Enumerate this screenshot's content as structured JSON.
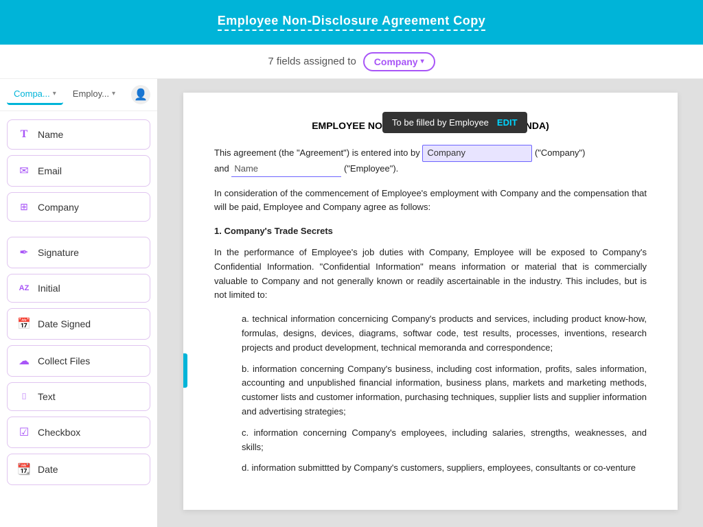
{
  "header": {
    "title": "Employee Non-Disclosure Agreement Copy"
  },
  "subheader": {
    "fields_text": "7 fields assigned to",
    "company_label": "Company",
    "chevron": "▾"
  },
  "sidebar": {
    "tabs": [
      {
        "id": "company",
        "label": "Compa...",
        "active": true
      },
      {
        "id": "employee",
        "label": "Employ...",
        "active": false
      }
    ],
    "add_icon": "+",
    "fields": [
      {
        "id": "name",
        "icon": "T",
        "icon_type": "text-t",
        "label": "Name"
      },
      {
        "id": "email",
        "icon": "✉",
        "icon_type": "email",
        "label": "Email"
      },
      {
        "id": "company",
        "icon": "⊞",
        "icon_type": "company",
        "label": "Company"
      },
      {
        "id": "signature",
        "icon": "✒",
        "icon_type": "signature",
        "label": "Signature"
      },
      {
        "id": "initial",
        "icon": "AZ",
        "icon_type": "initial",
        "label": "Initial"
      },
      {
        "id": "date-signed",
        "icon": "📅",
        "icon_type": "calendar",
        "label": "Date Signed"
      },
      {
        "id": "collect-files",
        "icon": "☁",
        "icon_type": "upload",
        "label": "Collect Files"
      },
      {
        "id": "text",
        "icon": "⌷",
        "icon_type": "text-box",
        "label": "Text"
      },
      {
        "id": "checkbox",
        "icon": "☑",
        "icon_type": "checkbox",
        "label": "Checkbox"
      },
      {
        "id": "date",
        "icon": "📆",
        "icon_type": "date",
        "label": "Date"
      }
    ]
  },
  "tooltip": {
    "text": "To be filled by Employee",
    "edit_label": "EDIT"
  },
  "document": {
    "title": "EMPLOYEE NON-DISCLOSURE AGREEMENT (NDA)",
    "intro": "This agreement (the \"Agreement\") is entered into by",
    "company_field_text": "Company",
    "company_suffix": " (\"Company\")",
    "and_text": "and",
    "name_field_text": "Name",
    "name_suffix": " (\"Employee\").",
    "para1": "In consideration of the commencement of Employee's employment with Company and the compensation that will be paid, Employee and Company agree as follows:",
    "section1_title": "1. Company's Trade Secrets",
    "section1_para": "In the performance of Employee's job duties with Company, Employee will be exposed to Company's Confidential Information. \"Confidential Information\" means information or material that is commercially valuable to Company and not generally known or readily ascertainable in the industry. This includes, but is not limited to:",
    "item_a": "a. technical information concernicing Company's products and services, including product know-how, formulas, designs, devices, diagrams, softwar code, test results, processes, inventions, research projects and product development, technical memoranda and correspondence;",
    "item_b": "b. information concerning Company's business, including cost information, profits, sales information, accounting and unpublished financial information, business plans, markets and marketing methods, customer lists and customer information, purchasing techniques, supplier lists and supplier information and advertising strategies;",
    "item_c": "c. information concerning Company's employees, including salaries, strengths, weaknesses, and skills;",
    "item_d": "d. information submittted by Company's customers, suppliers, employees, consultants or co-venture"
  },
  "colors": {
    "header_bg": "#00b4d8",
    "accent_purple": "#a855f7",
    "accent_blue": "#6c63ff",
    "field_highlight": "#e8e4ff"
  }
}
